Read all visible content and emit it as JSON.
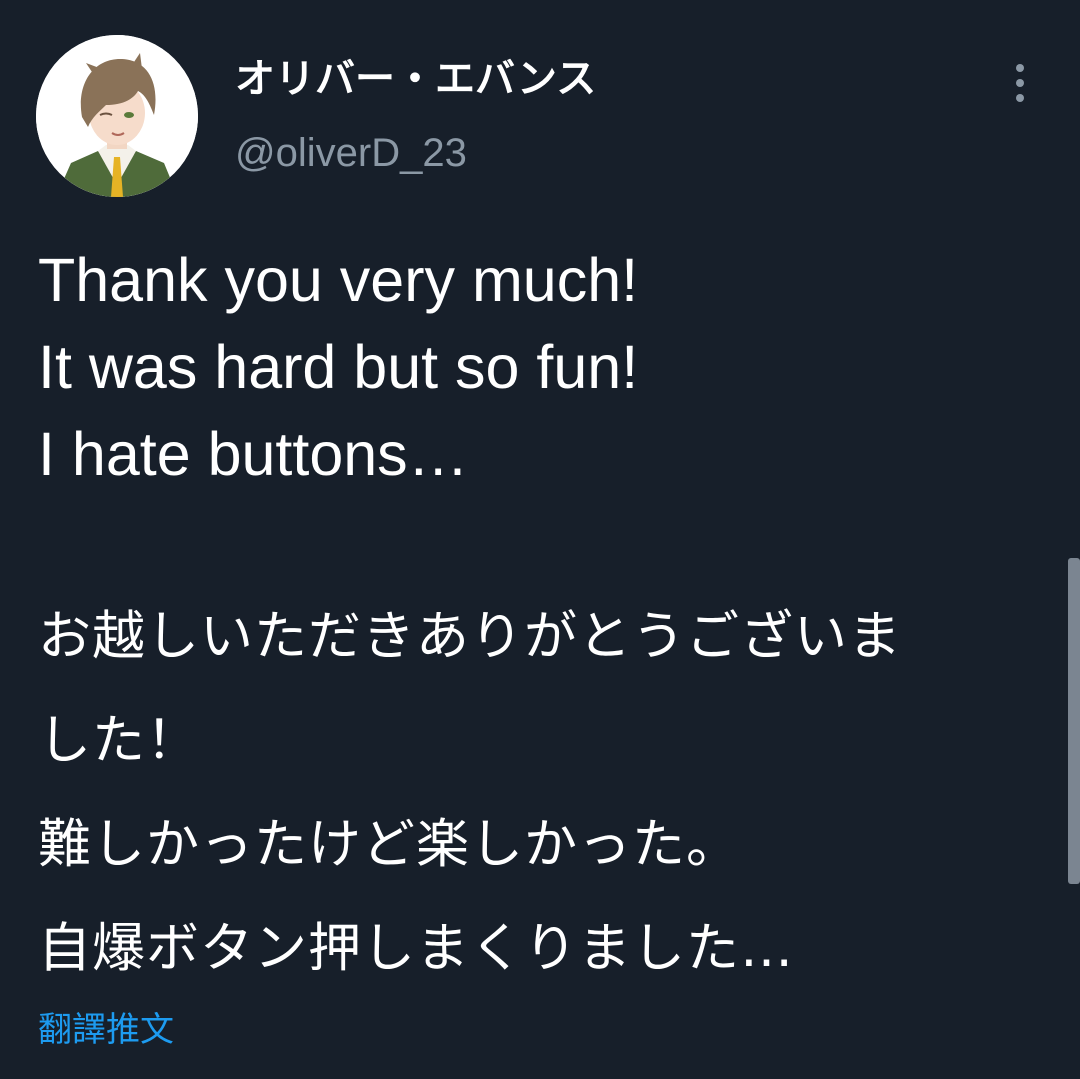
{
  "author": {
    "display_name": "オリバー・エバンス",
    "handle": "@oliverD_23",
    "avatar_icon": "avatar-illustration"
  },
  "more_icon": "vertical-ellipsis-icon",
  "tweet": {
    "lines_en": [
      "Thank you very much!",
      "It was hard but so fun!",
      "I hate buttons…"
    ],
    "lines_ja": [
      "お越しいただきありがとうございま",
      "した！",
      "難しかったけど楽しかった。",
      "自爆ボタン押しまくりました…"
    ]
  },
  "translate_label": "翻譯推文",
  "colors": {
    "background": "#171f2a",
    "text": "#ffffff",
    "secondary": "#8b98a5",
    "link": "#1d9bf0"
  }
}
